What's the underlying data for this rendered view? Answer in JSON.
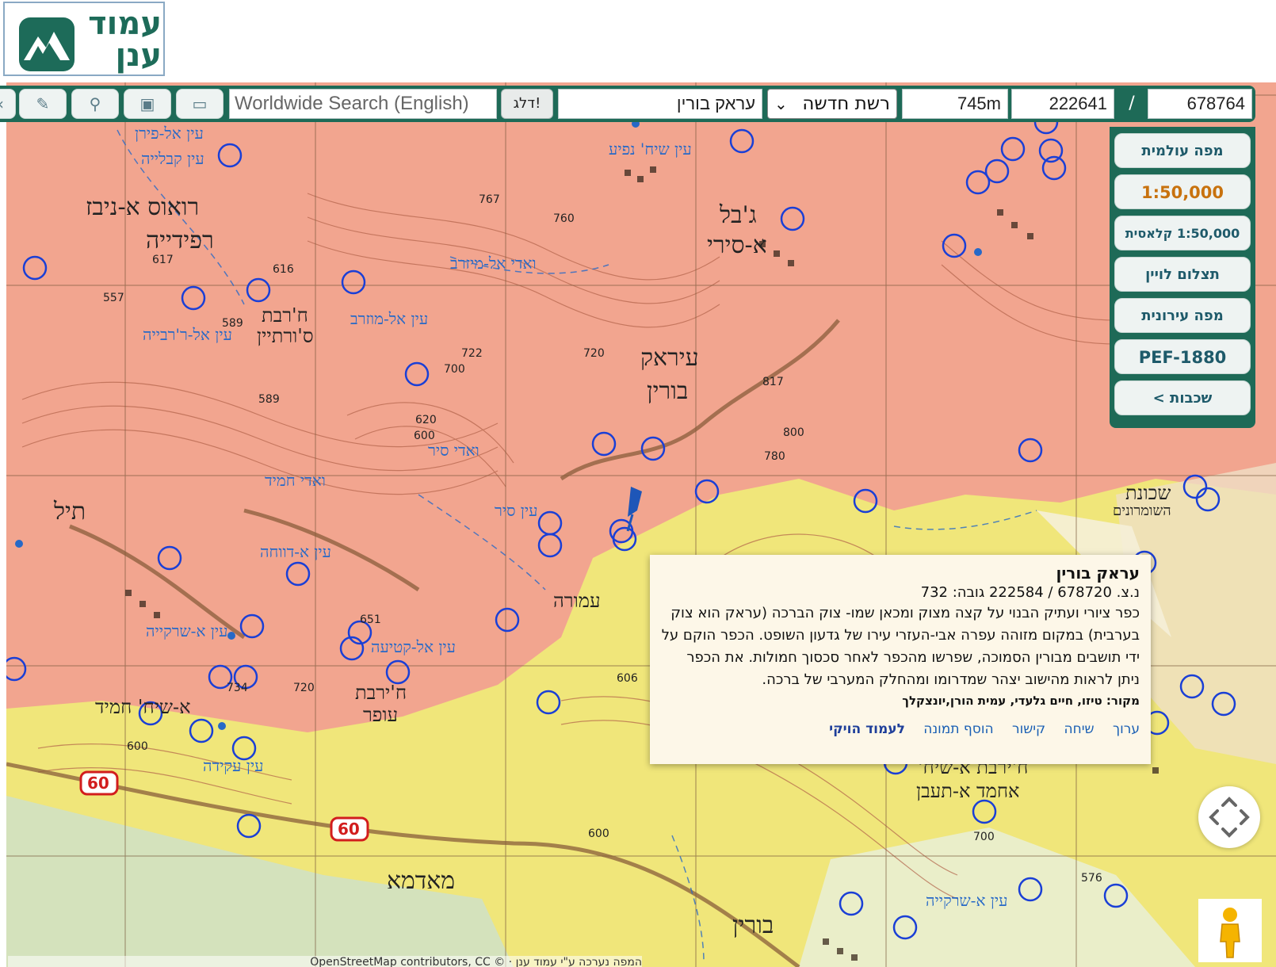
{
  "logo": {
    "text_line1": "עמוד",
    "text_line2": "ענן"
  },
  "toolbar": {
    "search_placeholder": "Worldwide Search (English)",
    "jump_label": "דלג!",
    "place_field": "עראק בורין",
    "grid_select": "רשת חדשה",
    "elevation": "745m",
    "coord_x": "222641",
    "slash": "/",
    "coord_y": "678764",
    "icons": [
      "chevron-left-icon",
      "pencil-icon",
      "pin-icon",
      "save-icon",
      "folder-icon"
    ]
  },
  "sidepanel": {
    "buttons": [
      "מפה עולמית",
      "1:50,000",
      "1:50,000 קלאסית",
      "תצלום לויין",
      "מפה עירונית",
      "PEF-1880",
      "שכבות >"
    ],
    "active_index": 1
  },
  "popup": {
    "title": "עראק בורין",
    "coords": "נ.צ. 678720 / 222584   גובה: 732",
    "description": "כפר ציורי ועתיק הבנוי על קצה מצוק ומכאן שמו- צוק הברכה (עראק הוא צוק בערבית) במקום מזוהה עפרה אבי-העזרי עירו של גדעון השופט. הכפר הוקם על ידי תושבים מבורין הסמוכה, שפרשו מהכפר לאחר סכסוך חמולות. את הכפר ניתן לראות מהישוב יצהר שמדרומו ומהחלק המערבי של ברכה.",
    "source": "מקור: טיזו, חיים גלעדי, עמית הורן,יונצקלך",
    "links": [
      "ערוך",
      "שיחה",
      "קישור",
      "הוסף תמונה",
      "לעמוד הויקי"
    ]
  },
  "map_labels": [
    {
      "text": "עיראק",
      "big": true
    },
    {
      "text": "בורין",
      "big": true
    },
    {
      "text": "ג'בל",
      "big": true
    },
    {
      "text": "א-סירי",
      "big": true
    },
    {
      "text": "רואוס א-ניבז",
      "big": true
    },
    {
      "text": "רפידייה",
      "big": true
    },
    {
      "text": "ח'רבת",
      "big": false
    },
    {
      "text": "ס'ורתיין",
      "big": false
    },
    {
      "text": "תיל",
      "big": true
    },
    {
      "text": "מאדמא",
      "big": true
    },
    {
      "text": "בורין",
      "big": true
    },
    {
      "text": "ח'ירבת",
      "big": false
    },
    {
      "text": "עופר",
      "big": false
    },
    {
      "text": "שכונת",
      "big": false
    },
    {
      "text": "השומרונים",
      "big": false
    },
    {
      "text": "אחמד א-תעבן",
      "big": false
    },
    {
      "text": "ח'ירבת א-שיח'",
      "big": false
    },
    {
      "text": "א-שיח' חמיד",
      "big": false
    },
    {
      "text": "עמורה",
      "big": false
    }
  ],
  "blue_labels": [
    "עין אל-מוזרב",
    "עין שיח' נפיע",
    "ואדי אל-מיזרב",
    "עין סיר",
    "עין א-דווחה",
    "עין אל-קטיעה",
    "עין אל-ר'רבייה",
    "עין א-שרקייה",
    "עין עקידה",
    "ואדי סיר",
    "ואדי חמיד",
    "עין אל-פירן",
    "עין קבלייה",
    "עין א-שרקייה"
  ],
  "spot_heights": [
    "767",
    "760",
    "616",
    "617",
    "589",
    "589",
    "557",
    "722",
    "720",
    "817",
    "620",
    "600",
    "800",
    "780",
    "700",
    "734",
    "720",
    "600",
    "651",
    "606",
    "576",
    "600",
    "700"
  ],
  "road_numbers": [
    "60",
    "60"
  ],
  "attribution": "המפה נערכה ע\"י עמוד ענן · © OpenStreetMap contributors, CC",
  "controls": {
    "pan": "pan-arrows-icon",
    "pegman": "pegman-icon"
  },
  "colors": {
    "brand": "#1e6a57",
    "urban": "#f2a58f",
    "rural": "#f0e67a",
    "water": "#2769c7",
    "marker": "#1a3fd6",
    "active": "#c8720e"
  }
}
